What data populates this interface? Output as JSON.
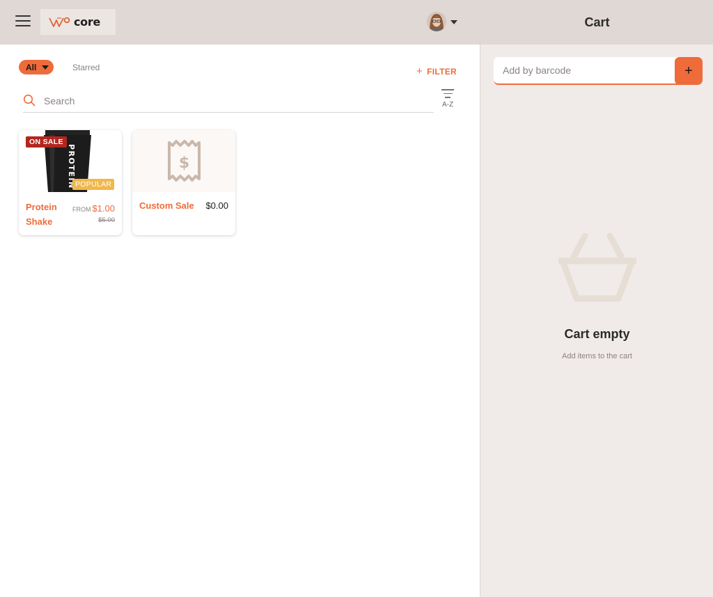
{
  "header": {
    "logo_text": "core"
  },
  "filters": {
    "all_label": "All",
    "starred_label": "Starred",
    "filter_label": "FILTER",
    "filter_plus": "+"
  },
  "search": {
    "placeholder": "Search",
    "value": "",
    "sort_label": "A-Z"
  },
  "products": [
    {
      "name": "Protein Shake",
      "price_prefix": "FROM",
      "price": "$1.00",
      "old_price": "$5.00",
      "badge_sale": "ON SALE",
      "badge_popular": "POPULAR",
      "image_text": "PROTEIN"
    },
    {
      "name": "Custom Sale",
      "price": "$0.00",
      "icon": "receipt-dollar-icon"
    }
  ],
  "cart": {
    "title": "Cart",
    "barcode_placeholder": "Add by barcode",
    "add_symbol": "+",
    "empty_title": "Cart empty",
    "empty_subtitle": "Add items to the cart"
  },
  "colors": {
    "accent": "#ef6b3a",
    "header_bg": "#e0d8d4",
    "cart_bg": "#f0ebe8",
    "sale_badge": "#b3261e",
    "popular_badge": "#f1b84a"
  }
}
